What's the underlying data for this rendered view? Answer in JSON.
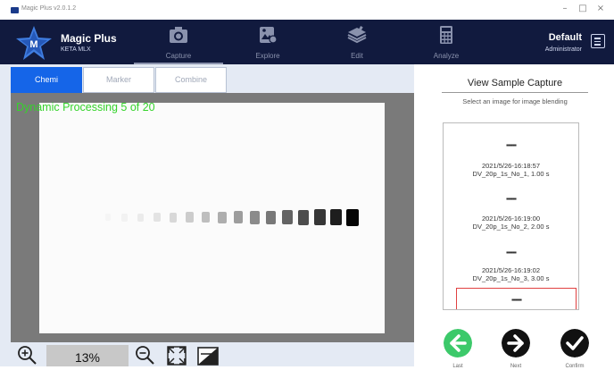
{
  "window": {
    "title": "Magic Plus v2.0.1.2",
    "controls": [
      "–",
      "□",
      "×"
    ]
  },
  "brand": {
    "name": "Magic Plus",
    "sub": "KETA MLX",
    "logo_letter": "M"
  },
  "nav": [
    {
      "label": "Capture",
      "icon": "camera-icon",
      "active": true
    },
    {
      "label": "Explore",
      "icon": "image-icon",
      "active": false
    },
    {
      "label": "Edit",
      "icon": "layers-icon",
      "active": false
    },
    {
      "label": "Analyze",
      "icon": "calculator-icon",
      "active": false
    }
  ],
  "user": {
    "name": "Default",
    "role": "Administrator"
  },
  "modes": [
    {
      "label": "Chemi",
      "active": true
    },
    {
      "label": "Marker",
      "active": false
    },
    {
      "label": "Combine",
      "active": false
    }
  ],
  "viewer": {
    "overlay": "Dynamic Processing 5 of 20"
  },
  "zoom": {
    "value": "13%"
  },
  "panel": {
    "title": "View Sample Capture",
    "subtitle": "Select an image for image blending",
    "items": [
      {
        "dots": "▪▪▪▪▪▪",
        "time": "2021/5/26-16:18:57",
        "name": "DV_20p_1s_No_1, 1.00 s"
      },
      {
        "dots": "▪▪▪▪▪▪",
        "time": "2021/5/26-16:19:00",
        "name": "DV_20p_1s_No_2, 2.00 s"
      },
      {
        "dots": "▪▪▪▪▪▪",
        "time": "2021/5/26-16:19:02",
        "name": "DV_20p_1s_No_3, 3.00 s"
      },
      {
        "dots": "▪▪▪▪▪▪",
        "time": "",
        "name": ""
      }
    ]
  },
  "actions": [
    {
      "label": "Last",
      "icon": "arrow-left-icon",
      "color": "#3cc96a"
    },
    {
      "label": "Next",
      "icon": "arrow-right-icon",
      "color": "#111111"
    },
    {
      "label": "Confirm",
      "icon": "checkmark-icon",
      "color": "#111111"
    }
  ]
}
